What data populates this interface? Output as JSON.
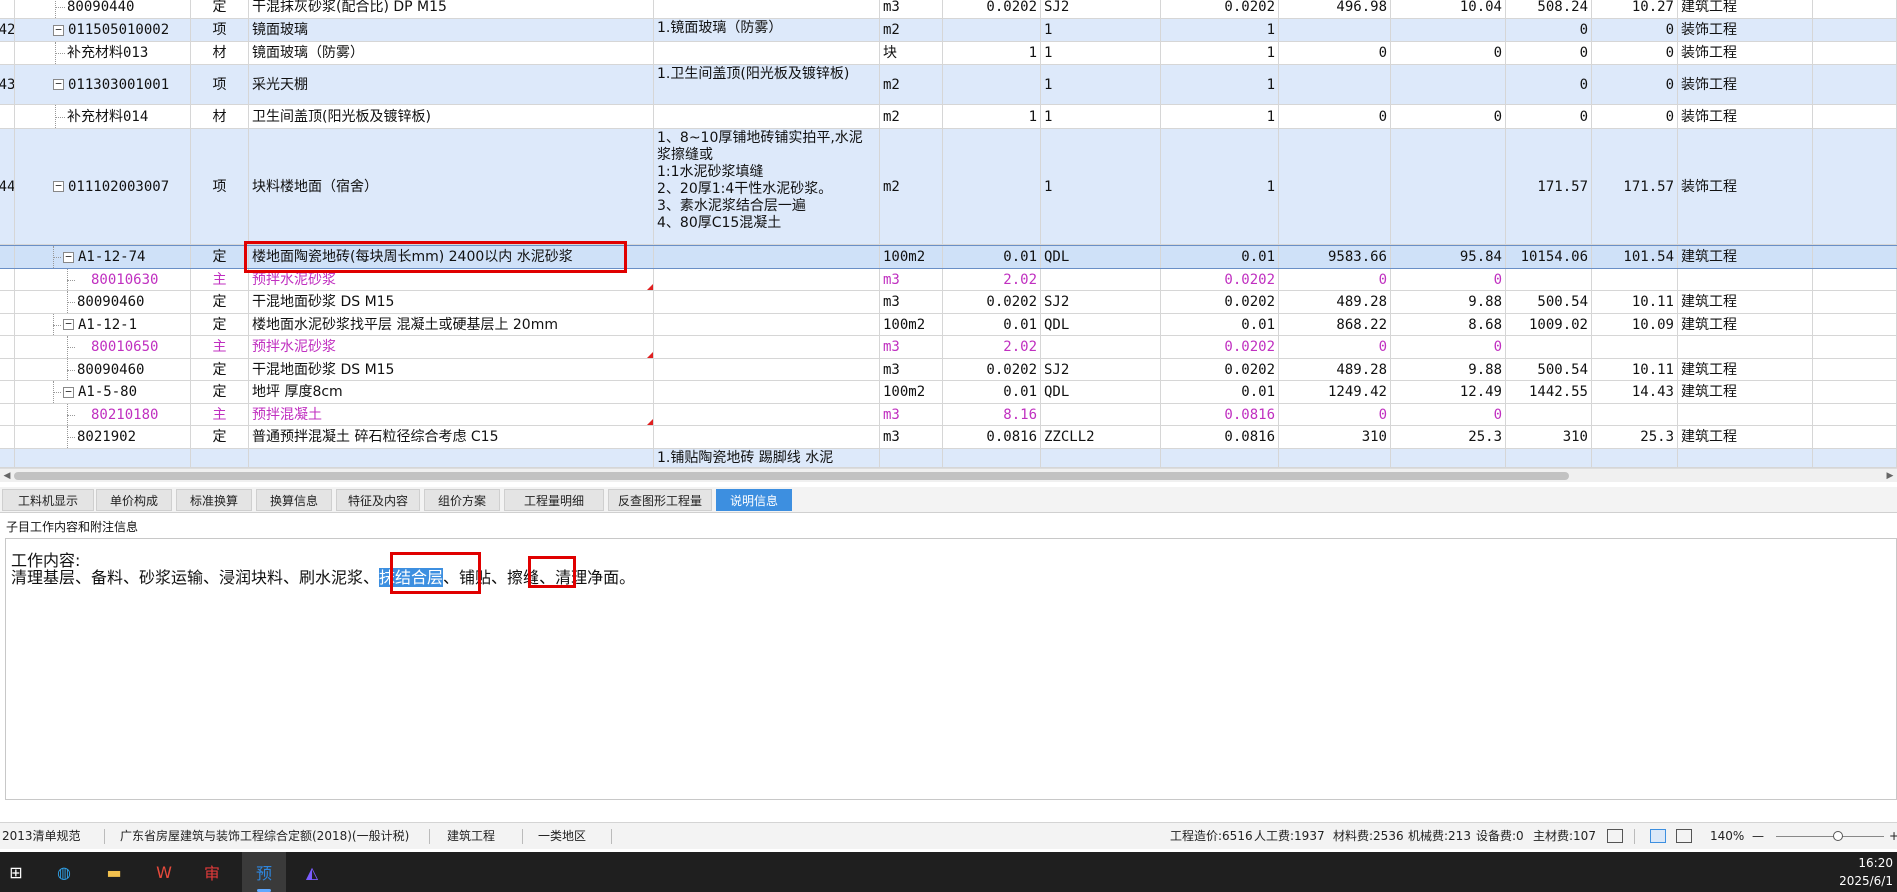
{
  "grid": {
    "rows": [
      {
        "num": "",
        "code": "80090440",
        "type": "定",
        "name": "干混抹灰砂浆(配合比) DP M15",
        "feature": "",
        "unit": "m3",
        "qty": "0.0202",
        "expr": "SJ2",
        "amount": "0.0202",
        "price": "496.98",
        "total": "10.04",
        "price2": "508.24",
        "total2": "10.27",
        "category": "建筑工程",
        "color": "white",
        "pink": false
      },
      {
        "num": "42",
        "code": "011505010002",
        "type": "项",
        "name": "镜面玻璃",
        "feature": "1.镜面玻璃（防雾）",
        "unit": "m2",
        "qty": "",
        "expr": "1",
        "amount": "1",
        "price": "",
        "total": "",
        "price2": "0",
        "total2": "0",
        "category": "装饰工程",
        "color": "blue",
        "pink": false
      },
      {
        "num": "",
        "code": "补充材料013",
        "type": "材",
        "name": "镜面玻璃（防雾）",
        "feature": "",
        "unit": "块",
        "qty": "1",
        "expr": "1",
        "amount": "1",
        "price": "0",
        "total": "0",
        "price2": "0",
        "total2": "0",
        "category": "装饰工程",
        "color": "white",
        "pink": false
      },
      {
        "num": "43",
        "code": "011303001001",
        "type": "项",
        "name": "采光天棚",
        "feature": "1.卫生间盖顶(阳光板及镀锌板)",
        "unit": "m2",
        "qty": "",
        "expr": "1",
        "amount": "1",
        "price": "",
        "total": "",
        "price2": "0",
        "total2": "0",
        "category": "装饰工程",
        "color": "blue",
        "pink": false
      },
      {
        "num": "",
        "code": "补充材料014",
        "type": "材",
        "name": "卫生间盖顶(阳光板及镀锌板)",
        "feature": "",
        "unit": "m2",
        "qty": "1",
        "expr": "1",
        "amount": "1",
        "price": "0",
        "total": "0",
        "price2": "0",
        "total2": "0",
        "category": "装饰工程",
        "color": "white",
        "pink": false
      },
      {
        "num": "44",
        "code": "011102003007",
        "type": "项",
        "name": "块料楼地面（宿舍）",
        "feature": "1、8~10厚铺地砖铺实拍平,水泥浆擦缝或\n1:1水泥砂浆填缝\n2、20厚1:4干性水泥砂浆。\n3、素水泥浆结合层一遍\n4、80厚C15混凝土",
        "unit": "m2",
        "qty": "",
        "expr": "1",
        "amount": "1",
        "price": "",
        "total": "",
        "price2": "171.57",
        "total2": "171.57",
        "category": "装饰工程",
        "color": "blue",
        "pink": false
      },
      {
        "num": "",
        "code": "A1-12-74",
        "type": "定",
        "name": "楼地面陶瓷地砖(每块周长mm) 2400以内 水泥砂浆",
        "feature": "",
        "unit": "100m2",
        "qty": "0.01",
        "expr": "QDL",
        "amount": "0.01",
        "price": "9583.66",
        "total": "95.84",
        "price2": "10154.06",
        "total2": "101.54",
        "category": "建筑工程",
        "color": "sel",
        "pink": false
      },
      {
        "num": "",
        "code": "80010630",
        "type": "主",
        "name": "预拌水泥砂浆",
        "feature": "",
        "unit": "m3",
        "qty": "2.02",
        "expr": "",
        "amount": "0.0202",
        "price": "0",
        "total": "0",
        "price2": "",
        "total2": "",
        "category": "",
        "color": "white",
        "pink": true
      },
      {
        "num": "",
        "code": "80090460",
        "type": "定",
        "name": "干混地面砂浆 DS M15",
        "feature": "",
        "unit": "m3",
        "qty": "0.0202",
        "expr": "SJ2",
        "amount": "0.0202",
        "price": "489.28",
        "total": "9.88",
        "price2": "500.54",
        "total2": "10.11",
        "category": "建筑工程",
        "color": "white",
        "pink": false
      },
      {
        "num": "",
        "code": "A1-12-1",
        "type": "定",
        "name": "楼地面水泥砂浆找平层 混凝土或硬基层上 20mm",
        "feature": "",
        "unit": "100m2",
        "qty": "0.01",
        "expr": "QDL",
        "amount": "0.01",
        "price": "868.22",
        "total": "8.68",
        "price2": "1009.02",
        "total2": "10.09",
        "category": "建筑工程",
        "color": "white",
        "pink": false
      },
      {
        "num": "",
        "code": "80010650",
        "type": "主",
        "name": "预拌水泥砂浆",
        "feature": "",
        "unit": "m3",
        "qty": "2.02",
        "expr": "",
        "amount": "0.0202",
        "price": "0",
        "total": "0",
        "price2": "",
        "total2": "",
        "category": "",
        "color": "white",
        "pink": true
      },
      {
        "num": "",
        "code": "80090460",
        "type": "定",
        "name": "干混地面砂浆 DS M15",
        "feature": "",
        "unit": "m3",
        "qty": "0.0202",
        "expr": "SJ2",
        "amount": "0.0202",
        "price": "489.28",
        "total": "9.88",
        "price2": "500.54",
        "total2": "10.11",
        "category": "建筑工程",
        "color": "white",
        "pink": false
      },
      {
        "num": "",
        "code": "A1-5-80",
        "type": "定",
        "name": "地坪 厚度8cm",
        "feature": "",
        "unit": "100m2",
        "qty": "0.01",
        "expr": "QDL",
        "amount": "0.01",
        "price": "1249.42",
        "total": "12.49",
        "price2": "1442.55",
        "total2": "14.43",
        "category": "建筑工程",
        "color": "white",
        "pink": false
      },
      {
        "num": "",
        "code": "80210180",
        "type": "主",
        "name": "预拌混凝土",
        "feature": "",
        "unit": "m3",
        "qty": "8.16",
        "expr": "",
        "amount": "0.0816",
        "price": "0",
        "total": "0",
        "price2": "",
        "total2": "",
        "category": "",
        "color": "white",
        "pink": true
      },
      {
        "num": "",
        "code": "8021902",
        "type": "定",
        "name": "普通预拌混凝土 碎石粒径综合考虑 C15",
        "feature": "",
        "unit": "m3",
        "qty": "0.0816",
        "expr": "ZZCLL2",
        "amount": "0.0816",
        "price": "310",
        "total": "25.3",
        "price2": "310",
        "total2": "25.3",
        "category": "建筑工程",
        "color": "white",
        "pink": false
      },
      {
        "num": "",
        "code": "",
        "type": "",
        "name": "",
        "feature": "1.铺贴陶瓷地砖 踢脚线 水泥",
        "unit": "",
        "qty": "",
        "expr": "",
        "amount": "",
        "price": "",
        "total": "",
        "price2": "",
        "total2": "",
        "category": "",
        "color": "blue",
        "pink": false
      }
    ]
  },
  "tabs": [
    {
      "label": "工料机显示",
      "active": false
    },
    {
      "label": "单价构成",
      "active": false
    },
    {
      "label": "标准换算",
      "active": false
    },
    {
      "label": "换算信息",
      "active": false
    },
    {
      "label": "特征及内容",
      "active": false
    },
    {
      "label": "组价方案",
      "active": false
    },
    {
      "label": "工程量明细",
      "active": false
    },
    {
      "label": "反查图形工程量",
      "active": false
    },
    {
      "label": "说明信息",
      "active": true
    }
  ],
  "info": {
    "header": "子目工作内容和附注信息",
    "line1": "工作内容:",
    "seg1": "清理基层、备料、砂浆运输、浸润块料、刷水泥浆、",
    "seg2": "抹结合层",
    "seg3": "、铺贴、",
    "seg4": "擦缝",
    "seg5": "、清理净面。"
  },
  "status": {
    "spec": "2013清单规范",
    "quota": "广东省房屋建筑与装饰工程综合定额(2018)(一般计税)",
    "project_type": "建筑工程",
    "region": "一类地区",
    "cost": "工程造价:6516",
    "labor": "人工费:1937",
    "material": "材料费:2536",
    "machine": "机械费:213",
    "equipment": "设备费:0",
    "main_material": "主材费:107",
    "zoom": "140%",
    "zoom_minus": "—",
    "zoom_plus": "+"
  },
  "taskbar": {
    "icons": [
      {
        "name": "windows-start-icon",
        "glyph": "⊞",
        "color": "#ffffff"
      },
      {
        "name": "edge-browser-icon",
        "glyph": "◍",
        "color": "#2fa1e8"
      },
      {
        "name": "file-explorer-icon",
        "glyph": "▬",
        "color": "#f2c14e"
      },
      {
        "name": "wps-office-icon",
        "glyph": "W",
        "color": "#e64a3c"
      },
      {
        "name": "review-app-icon",
        "glyph": "审",
        "color": "#e03a3a"
      },
      {
        "name": "budget-app-icon",
        "glyph": "预",
        "color": "#2e86de"
      },
      {
        "name": "graphics-app-icon",
        "glyph": "◭",
        "color": "#7b5cff"
      }
    ],
    "time": "16:20",
    "date": "2025/6/1"
  }
}
